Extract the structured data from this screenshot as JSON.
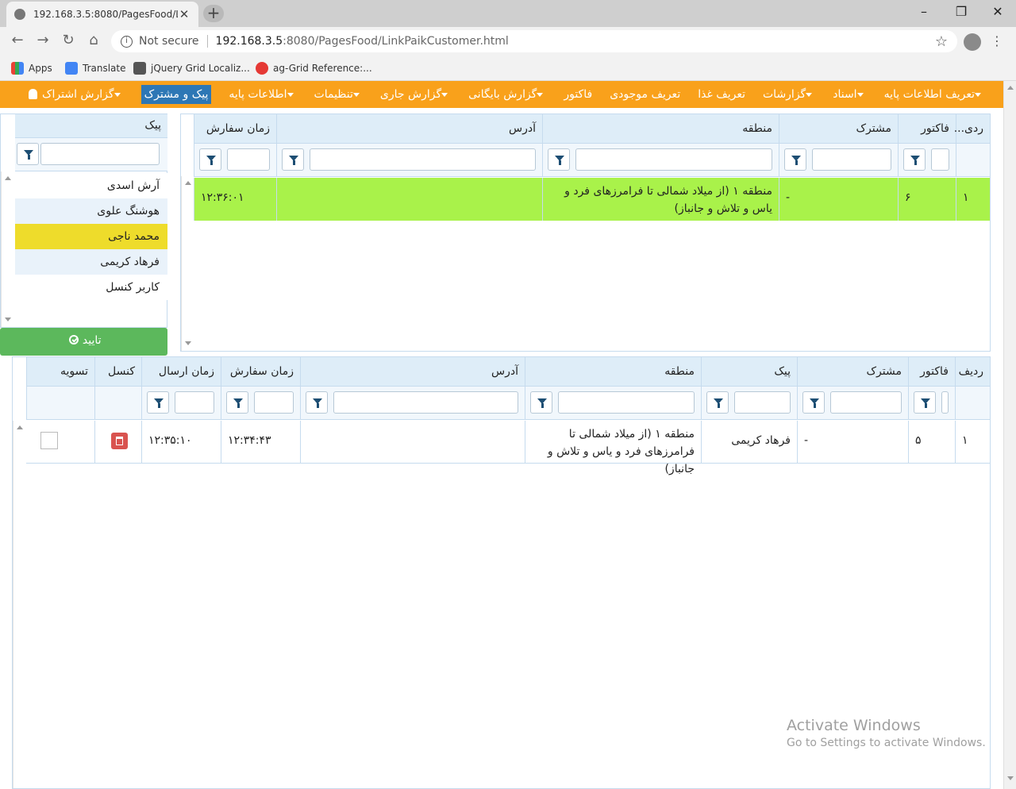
{
  "browser": {
    "tab_title": "192.168.3.5:8080/PagesFood/LinkPaikCustomer.html",
    "tab_title_short": "192.168.3.5:8080/PagesFood/Link",
    "security": "Not secure",
    "url_host": "192.168.3.5",
    "url_path": ":8080/PagesFood/LinkPaikCustomer.html",
    "bookmarks": [
      {
        "label": "Apps",
        "icon": "apps-grid-icon"
      },
      {
        "label": "Translate",
        "icon": "translate-icon"
      },
      {
        "label": "jQuery Grid Localiz...",
        "icon": "jquery-icon"
      },
      {
        "label": "ag-Grid Reference:...",
        "icon": "ag-grid-icon"
      }
    ]
  },
  "nav": {
    "items": [
      {
        "label": "تعریف اطلاعات پایه",
        "dropdown": true
      },
      {
        "label": "اسناد",
        "dropdown": true
      },
      {
        "label": "گزارشات",
        "dropdown": true
      },
      {
        "label": "تعریف غذا",
        "dropdown": false
      },
      {
        "label": "تعریف موجودی",
        "dropdown": false
      },
      {
        "label": "فاکتور",
        "dropdown": false
      },
      {
        "label": "گزارش بایگانی",
        "dropdown": true
      },
      {
        "label": "گزارش جاری",
        "dropdown": true
      },
      {
        "label": "تنظیمات",
        "dropdown": true
      },
      {
        "label": "اطلاعات پایه",
        "dropdown": true
      },
      {
        "label": "پیک و مشترک",
        "dropdown": false,
        "active": true
      },
      {
        "label": "گزارش اشتراک",
        "dropdown": true
      }
    ],
    "accent": "#f9a11b",
    "active_color": "#2d77b5"
  },
  "courier_list": {
    "header": "پیک",
    "filter_value": "",
    "items": [
      "آرش اسدی",
      "هوشنگ علوی",
      "محمد ناجی",
      "فرهاد کریمی",
      "کاربر کنسل"
    ],
    "selected_index": 2,
    "confirm_label": "تایید"
  },
  "orders_grid": {
    "columns": [
      "ردی...",
      "فاکتور",
      "مشترک",
      "منطقه",
      "آدرس",
      "زمان سفارش"
    ],
    "rows": [
      {
        "row": "۱",
        "invoice": "۶",
        "customer": "-",
        "region": "منطقه ۱ (از میلاد شمالی تا فرامرزهای فرد و یاس و تلاش و جانباز)",
        "address": "",
        "order_time": "۱۲:۳۶:۰۱"
      }
    ],
    "selected_row_color": "#a9f24a"
  },
  "assigned_grid": {
    "columns": [
      "ردیف",
      "فاکتور",
      "مشترک",
      "پیک",
      "منطقه",
      "آدرس",
      "زمان سفارش",
      "زمان ارسال",
      "کنسل",
      "تسویه"
    ],
    "rows": [
      {
        "row": "۱",
        "invoice": "۵",
        "customer": "-",
        "courier": "فرهاد کریمی",
        "region": "منطقه ۱ (از میلاد شمالی تا فرامرزهای فرد و یاس و تلاش و جانباز)",
        "address": "",
        "order_time": "۱۲:۳۴:۴۳",
        "send_time": "۱۲:۳۵:۱۰",
        "settled": false
      }
    ]
  },
  "watermark": {
    "line1": "Activate Windows",
    "line2": "Go to Settings to activate Windows."
  }
}
